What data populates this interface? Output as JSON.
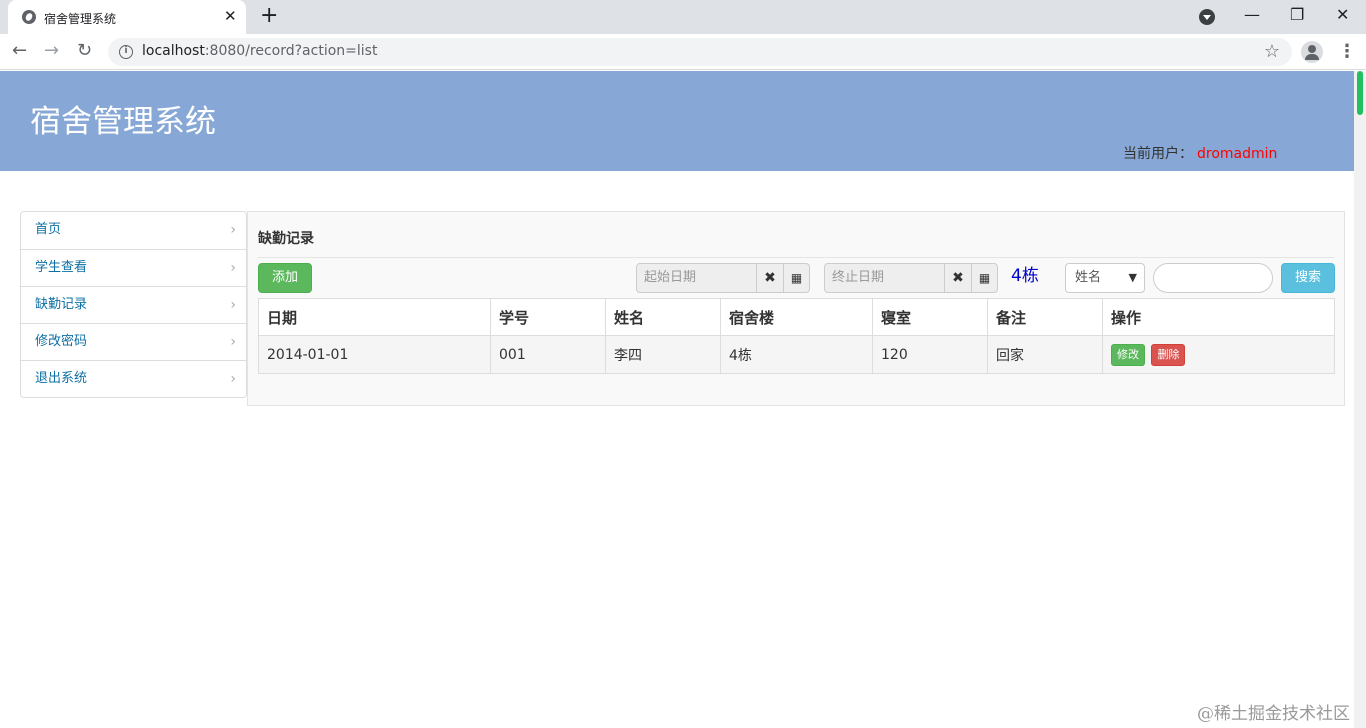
{
  "browser": {
    "tab_title": "宿舍管理系统",
    "url_host": "localhost",
    "url_rest": ":8080/record?action=list",
    "icons": [
      "globe-icon",
      "close-icon",
      "plus-icon",
      "back-icon",
      "forward-icon",
      "reload-icon",
      "info-icon",
      "star-icon",
      "account-icon",
      "menu-icon"
    ]
  },
  "header": {
    "brand": "宿舍管理系统",
    "current_user_label": "当前用户：",
    "current_user_name": "dromadmin",
    "name_color": "#ff0000",
    "banner_color": "#87a8d6"
  },
  "sidebar": {
    "items": [
      {
        "label": "首页"
      },
      {
        "label": "学生查看"
      },
      {
        "label": "缺勤记录"
      },
      {
        "label": "修改密码"
      },
      {
        "label": "退出系统"
      }
    ]
  },
  "main": {
    "title": "缺勤记录",
    "add_label": "添加",
    "start_date_placeholder": "起始日期",
    "end_date_placeholder": "终止日期",
    "building": "4栋",
    "search_field": "姓名",
    "search_value": "",
    "search_label": "搜索",
    "table": {
      "headers": [
        "日期",
        "学号",
        "姓名",
        "宿舍楼",
        "寝室",
        "备注",
        "操作"
      ],
      "rows": [
        {
          "date": "2014-01-01",
          "student_no": "001",
          "name": "李四",
          "building": "4栋",
          "room": "120",
          "note": "回家",
          "edit_label": "修改",
          "delete_label": "删除"
        }
      ]
    }
  },
  "watermark": "@稀土掘金技术社区"
}
